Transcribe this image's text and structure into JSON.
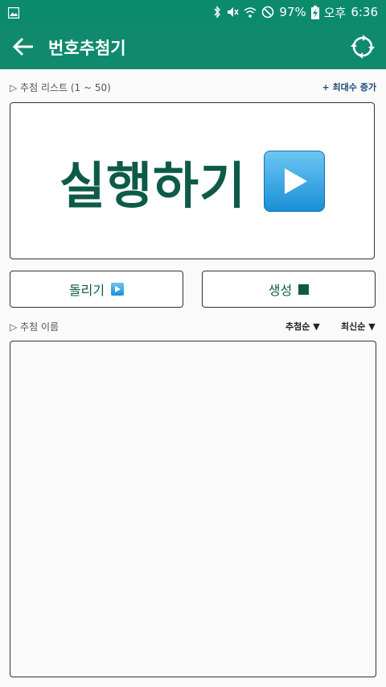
{
  "status_bar": {
    "battery": "97%",
    "ampm": "오후",
    "time": "6:36"
  },
  "app_bar": {
    "title": "번호추첨기"
  },
  "list_section": {
    "label": "▷ 추첨 리스트 (1 ~ 50)",
    "increase_max_label": "+ 최대수 증가"
  },
  "run_panel": {
    "label": "실행하기"
  },
  "buttons": {
    "spin_label": "돌리기",
    "generate_label": "생성"
  },
  "result_section": {
    "label": "▷ 추첨 이름",
    "sort_draw_label": "추첨순 ▼",
    "sort_latest_label": "최신순 ▼"
  }
}
